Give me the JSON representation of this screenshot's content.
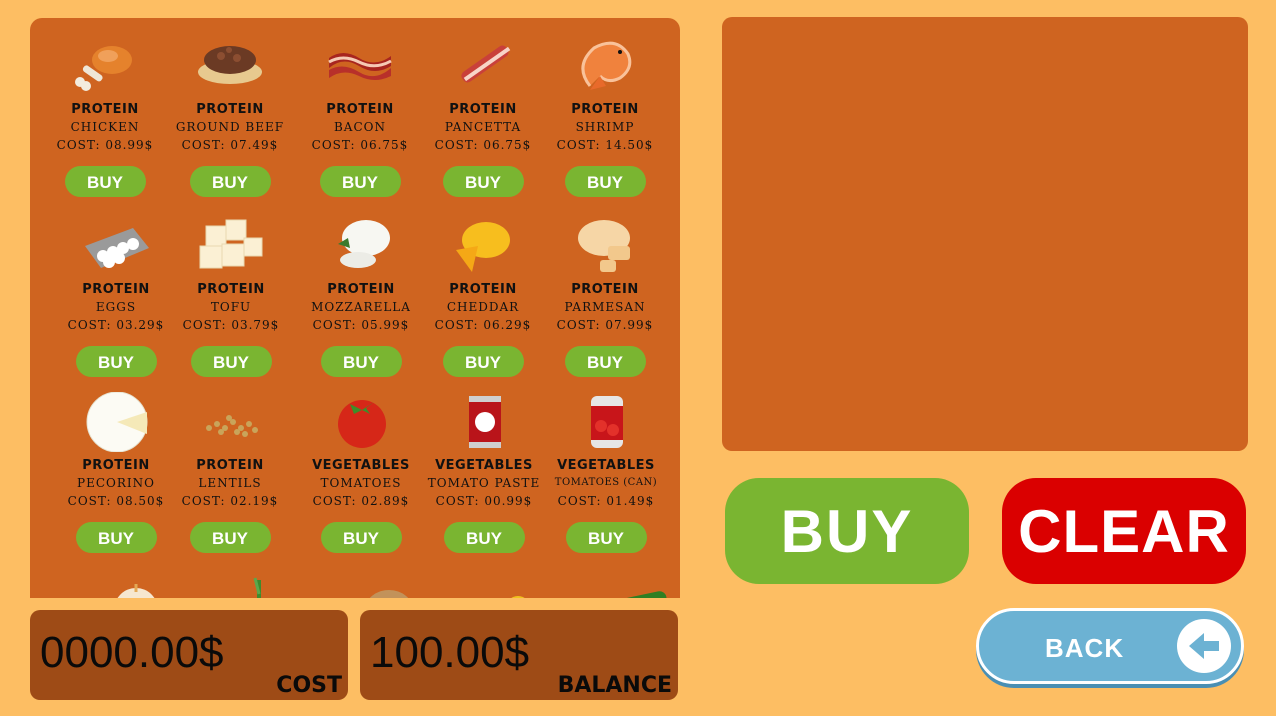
{
  "shop": {
    "items": [
      {
        "category": "PROTEIN",
        "name": "CHICKEN",
        "cost": "COST: 08.99$",
        "buy": "BUY",
        "icon": "chicken-drumstick-icon"
      },
      {
        "category": "PROTEIN",
        "name": "GROUND BEEF",
        "cost": "COST: 07.49$",
        "buy": "BUY",
        "icon": "ground-beef-icon"
      },
      {
        "category": "PROTEIN",
        "name": "BACON",
        "cost": "COST: 06.75$",
        "buy": "BUY",
        "icon": "bacon-icon"
      },
      {
        "category": "PROTEIN",
        "name": "PANCETTA",
        "cost": "COST: 06.75$",
        "buy": "BUY",
        "icon": "pancetta-icon"
      },
      {
        "category": "PROTEIN",
        "name": "SHRIMP",
        "cost": "COST: 14.50$",
        "buy": "BUY",
        "icon": "shrimp-icon"
      },
      {
        "category": "PROTEIN",
        "name": "EGGS",
        "cost": "COST: 03.29$",
        "buy": "BUY",
        "icon": "egg-carton-icon"
      },
      {
        "category": "PROTEIN",
        "name": "TOFU",
        "cost": "COST: 03.79$",
        "buy": "BUY",
        "icon": "tofu-icon"
      },
      {
        "category": "PROTEIN",
        "name": "MOZZARELLA",
        "cost": "COST: 05.99$",
        "buy": "BUY",
        "icon": "mozzarella-icon"
      },
      {
        "category": "PROTEIN",
        "name": "CHEDDAR",
        "cost": "COST: 06.29$",
        "buy": "BUY",
        "icon": "cheddar-icon"
      },
      {
        "category": "PROTEIN",
        "name": "PARMESAN",
        "cost": "COST: 07.99$",
        "buy": "BUY",
        "icon": "parmesan-icon"
      },
      {
        "category": "PROTEIN",
        "name": "PECORINO",
        "cost": "COST: 08.50$",
        "buy": "BUY",
        "icon": "pecorino-icon"
      },
      {
        "category": "PROTEIN",
        "name": "LENTILS",
        "cost": "COST: 02.19$",
        "buy": "BUY",
        "icon": "lentils-icon"
      },
      {
        "category": "VEGETABLES",
        "name": "TOMATOES",
        "cost": "COST: 02.89$",
        "buy": "BUY",
        "icon": "tomato-icon"
      },
      {
        "category": "VEGETABLES",
        "name": "TOMATO PASTE",
        "cost": "COST: 00.99$",
        "buy": "BUY",
        "icon": "tomato-paste-can-icon"
      },
      {
        "category": "VEGETABLES",
        "name": "TOMATOES (CAN)",
        "cost": "COST: 01.49$",
        "buy": "BUY",
        "icon": "tomato-can-icon"
      }
    ],
    "partial_icons": [
      "onion-icon",
      "scallion-icon",
      "potato-icon",
      "bell-pepper-icon",
      "zucchini-icon"
    ]
  },
  "actions": {
    "buy": "BUY",
    "clear": "CLEAR",
    "back": "BACK"
  },
  "totals": {
    "cost_value": "0000.00$",
    "cost_label": "COST",
    "balance_value": "100.00$",
    "balance_label": "BALANCE"
  }
}
